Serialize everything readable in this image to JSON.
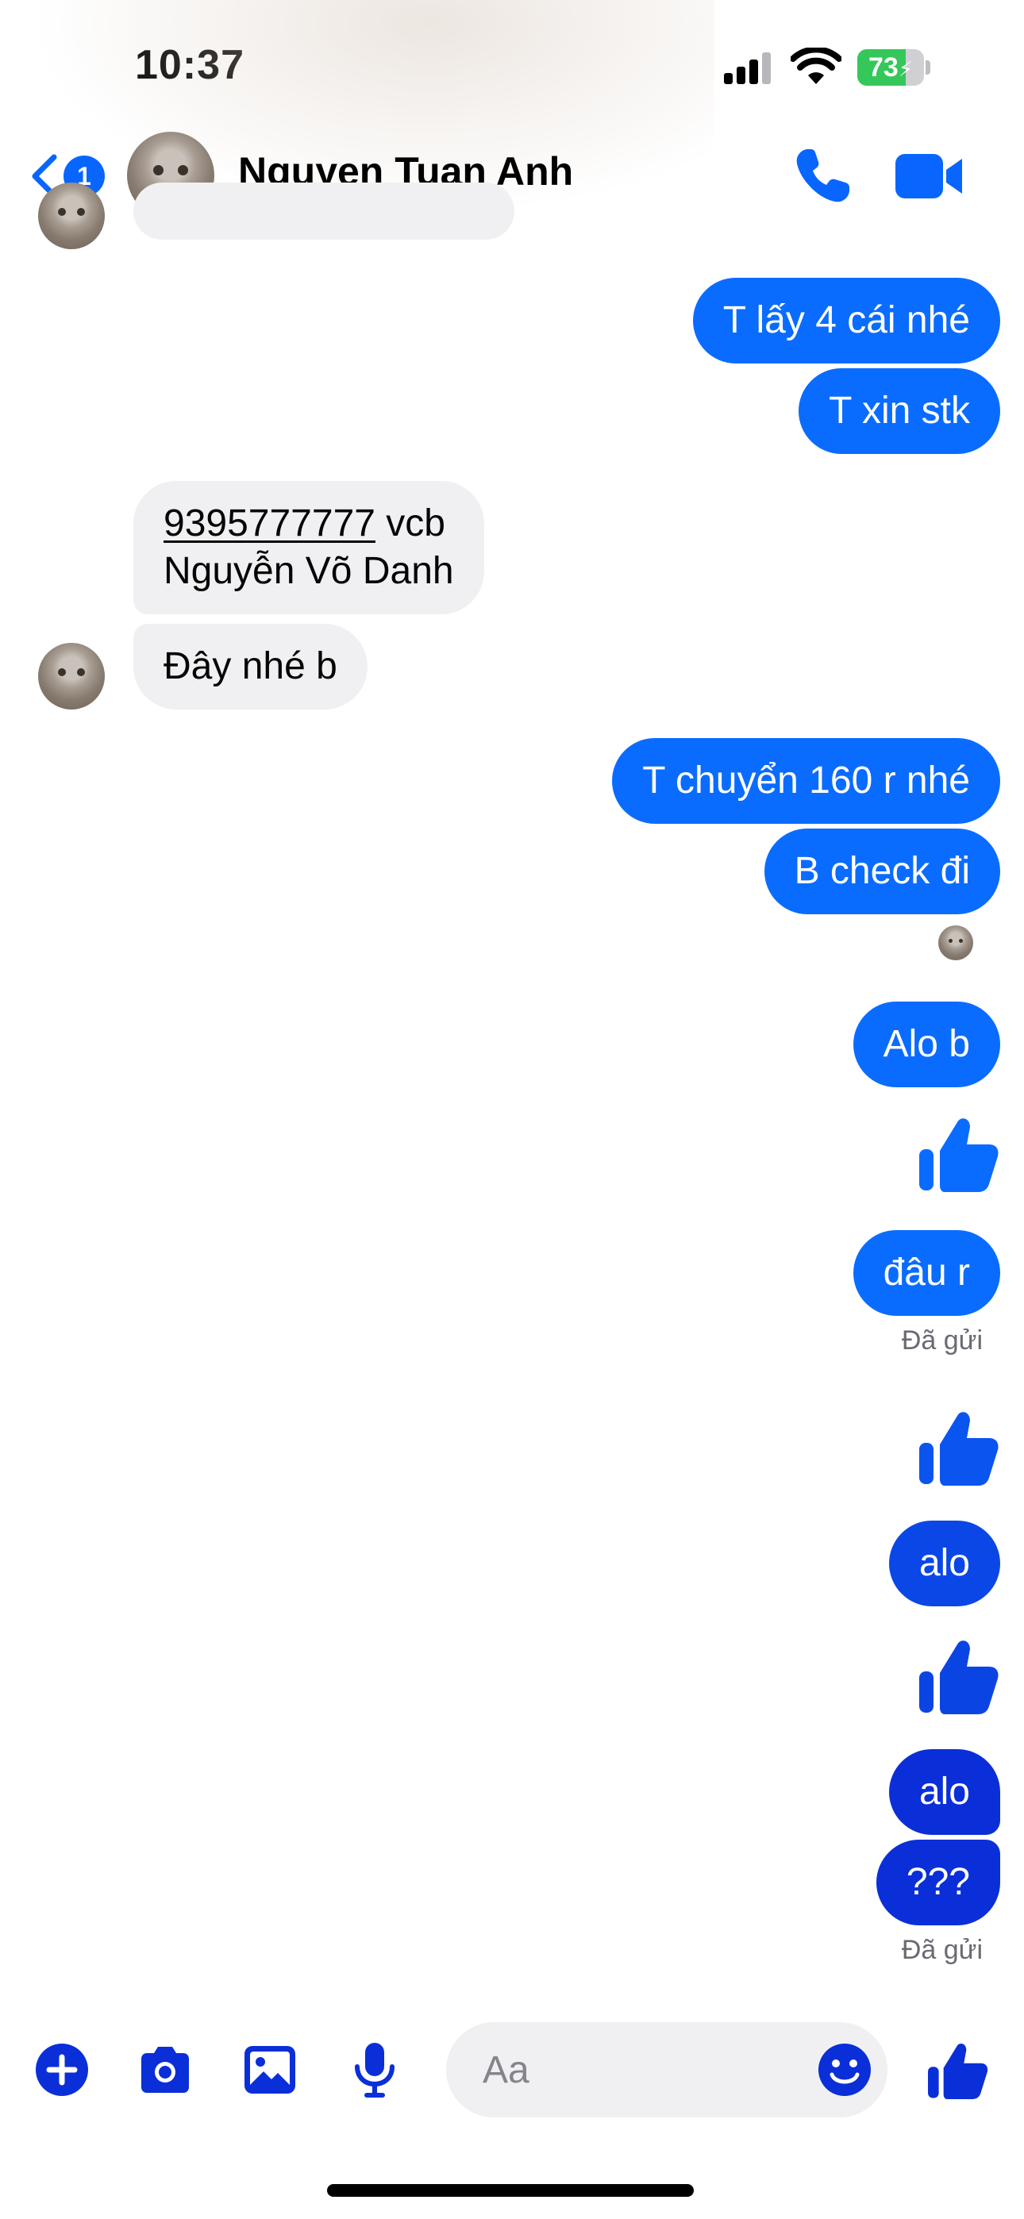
{
  "status_bar": {
    "time": "10:37",
    "battery_percent": 73,
    "battery_label": "73",
    "charging": true
  },
  "header": {
    "unread_count": "1",
    "contact_name": "Nguyen Tuan Anh",
    "icons": [
      "chevron-left-icon",
      "phone-icon",
      "video-camera-icon"
    ]
  },
  "messages": {
    "out_1": "T lấy 4 cái nhé",
    "out_2": "T xin stk",
    "in_account_number": "9395777777",
    "in_bank": " vcb",
    "in_account_name": "Nguyễn Võ Danh",
    "in_2": "Đây nhé b",
    "out_3": "T chuyển 160 r nhé",
    "out_4": "B check đi",
    "out_5": "Alo b",
    "out_6": "đâu r",
    "status_1": "Đã gửi",
    "out_7": "alo",
    "out_8": "alo",
    "out_9": "???",
    "status_2": "Đã gửi"
  },
  "composer": {
    "placeholder": "Aa",
    "icons": [
      "plus-icon",
      "camera-icon",
      "photo-icon",
      "microphone-icon",
      "emoji-icon",
      "like-icon"
    ]
  },
  "colors": {
    "accent": "#0866ff",
    "outgoing_bubble": "#0a6cff",
    "outgoing_bubble_late": "#0a2fd8",
    "incoming_bubble": "#f0f0f2",
    "battery_green": "#35c759"
  }
}
